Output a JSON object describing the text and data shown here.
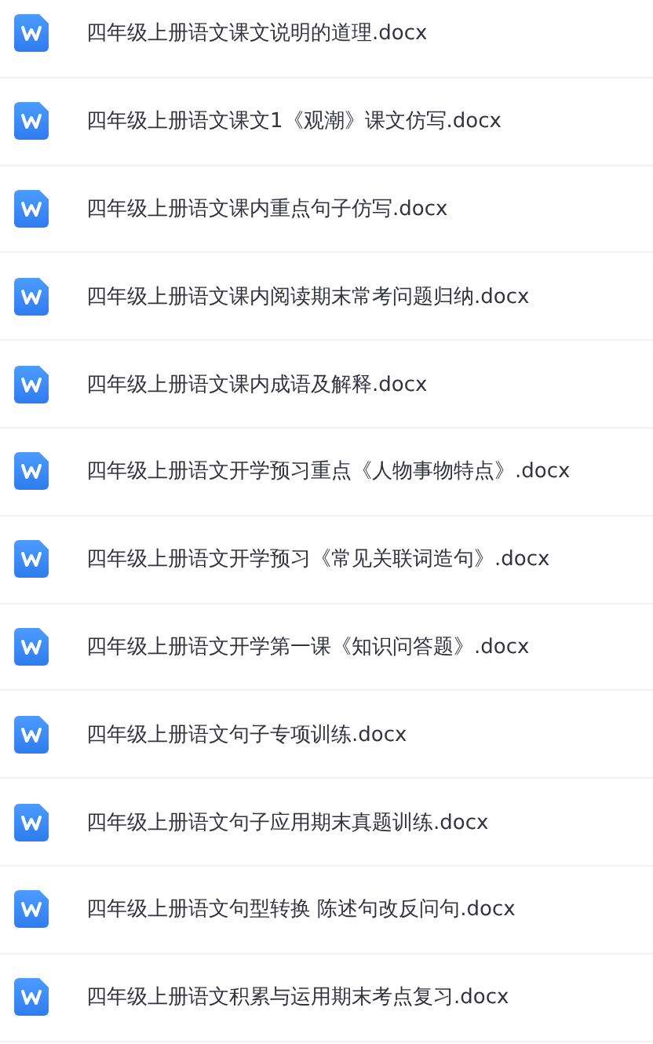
{
  "files": [
    {
      "name": "四年级上册语文课文说明的道理.docx"
    },
    {
      "name": "四年级上册语文课文1《观潮》课文仿写.docx"
    },
    {
      "name": "四年级上册语文课内重点句子仿写.docx"
    },
    {
      "name": "四年级上册语文课内阅读期末常考问题归纳.docx"
    },
    {
      "name": "四年级上册语文课内成语及解释.docx"
    },
    {
      "name": "四年级上册语文开学预习重点《人物事物特点》.docx"
    },
    {
      "name": "四年级上册语文开学预习《常见关联词造句》.docx"
    },
    {
      "name": "四年级上册语文开学第一课《知识问答题》.docx"
    },
    {
      "name": "四年级上册语文句子专项训练.docx"
    },
    {
      "name": "四年级上册语文句子应用期末真题训练.docx"
    },
    {
      "name": "四年级上册语文句型转换 陈述句改反问句.docx"
    },
    {
      "name": "四年级上册语文积累与运用期末考点复习.docx"
    }
  ]
}
